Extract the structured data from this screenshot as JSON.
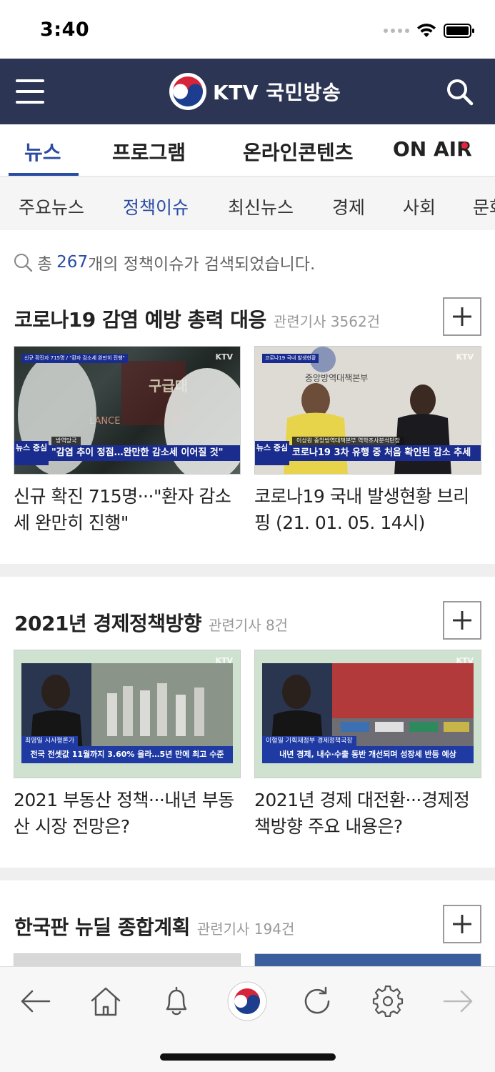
{
  "status_bar": {
    "time": "3:40"
  },
  "header": {
    "logo_text": "KTV 국민방송"
  },
  "main_tabs": [
    {
      "label": "뉴스",
      "active": true
    },
    {
      "label": "프로그램",
      "active": false
    },
    {
      "label": "온라인콘텐츠",
      "active": false
    },
    {
      "label": "ON AIR",
      "active": false
    }
  ],
  "sub_tabs": [
    {
      "label": "주요뉴스",
      "active": false
    },
    {
      "label": "정책이슈",
      "active": true
    },
    {
      "label": "최신뉴스",
      "active": false
    },
    {
      "label": "경제",
      "active": false
    },
    {
      "label": "사회",
      "active": false
    },
    {
      "label": "문화",
      "active": false
    }
  ],
  "result": {
    "prefix": "총",
    "count": "267",
    "suffix": "개의 정책이슈가 검색되었습니다."
  },
  "sections": [
    {
      "title": "코로나19 감염 예방 총력 대응",
      "count_label": "관련기사 3562건",
      "cards": [
        {
          "caption": "신규 확진 715명···\"환자 감소세 완만히 진행\"",
          "thumb_ktv": "KTV",
          "thumb_corner": "신규 확진자 715명 / \"환자 감소세 완만히 진행\"",
          "thumb_sub": "방역당국",
          "thumb_ticker": "\"감염 추이 정점…완만한 감소세 이어질 것\"",
          "thumb_badge": "뉴스 중심"
        },
        {
          "caption": "코로나19 국내 발생현황 브리핑 (21. 01. 05. 14시)",
          "thumb_ktv": "KTV",
          "thumb_corner": "코로나19 국내 발생현황",
          "thumb_sub": "이상원 중앙방역대책본부 역학조사분석단장",
          "thumb_ticker": "코로나19 3차 유행 중 처음 확인된 감소 추세",
          "thumb_badge": "뉴스 중심"
        }
      ]
    },
    {
      "title": "2021년 경제정책방향",
      "count_label": "관련기사 8건",
      "cards": [
        {
          "caption": "2021 부동산 정책···내년 부동산 시장 전망은?",
          "thumb_ktv": "KTV",
          "thumb_name": "최영일 시사평론가",
          "thumb_ticker": "전국 전셋값 11월까지 3.60% 올라…5년 만에 최고 수준"
        },
        {
          "caption": "2021년 경제 대전환···경제정책방향 주요 내용은?",
          "thumb_ktv": "KTV",
          "thumb_name": "이형일 기획재정부 경제정책국장",
          "thumb_ticker": "내년 경제, 내수·수출 동반 개선되며 성장세 반등 예상"
        }
      ]
    },
    {
      "title": "한국판 뉴딜 종합계획",
      "count_label": "관련기사 194건"
    }
  ],
  "colors": {
    "header_bg": "#2d3554",
    "accent": "#2a4ca3",
    "onair_dot": "#e8243d"
  },
  "icons": {
    "header": [
      "menu-icon",
      "search-icon"
    ],
    "bottom_bar": [
      "back-arrow-icon",
      "home-icon",
      "bell-icon",
      "ktv-emblem-icon",
      "refresh-icon",
      "settings-icon",
      "forward-arrow-icon"
    ]
  }
}
